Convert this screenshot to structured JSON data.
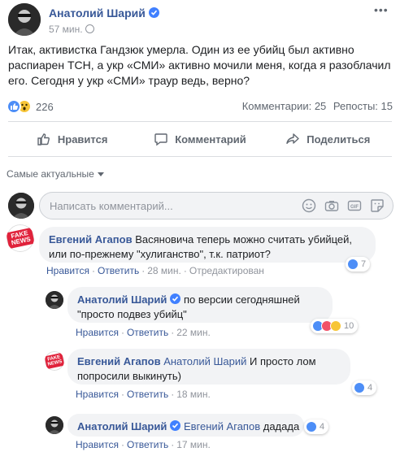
{
  "post": {
    "author": "Анатолий Шарий",
    "time": "57 мин.",
    "text": "Итак, активистка Гандзюк умерла. Один из ее убийц был активно распиарен ТСН, а укр «СМИ» активно мочили меня, когда я разоблачил его. Сегодня у укр «СМИ» траур ведь, верно?",
    "reaction_count": "226",
    "comments_label": "Комментарии: 25",
    "shares_label": "Репосты: 15"
  },
  "actions": {
    "like": "Нравится",
    "comment": "Комментарий",
    "share": "Поделиться"
  },
  "sort_label": "Самые актуальные",
  "composer": {
    "placeholder": "Написать комментарий..."
  },
  "fake_stamp": "FAKE NEWS",
  "comments": [
    {
      "author": "Евгений Агапов",
      "text": "Васяновича теперь можно считать убийцей, или по-прежнему \"хулиганство\", т.к. патриот?",
      "like": "Нравится",
      "reply": "Ответить",
      "time": "28 мин.",
      "edited": "Отредактирован",
      "reactions": "7"
    },
    {
      "author": "Анатолий Шарий",
      "text": "по версии сегодняшней \"просто подвез убийц\"",
      "like": "Нравится",
      "reply": "Ответить",
      "time": "22 мин.",
      "reactions": "10"
    },
    {
      "author": "Евгений Агапов",
      "mention": "Анатолий Шарий",
      "text": "И просто лом попросили выкинуть)",
      "like": "Нравится",
      "reply": "Ответить",
      "time": "18 мин.",
      "reactions": "4"
    },
    {
      "author": "Анатолий Шарий",
      "mention": "Евгений Агапов",
      "text": "дадада",
      "like": "Нравится",
      "reply": "Ответить",
      "time": "17 мин.",
      "reactions": "4"
    }
  ],
  "colors": {
    "link": "#385898",
    "like_blue": "#4d8ef7",
    "muted": "#90949c",
    "bubble": "#f2f3f5",
    "fake_red": "#e0223b"
  }
}
